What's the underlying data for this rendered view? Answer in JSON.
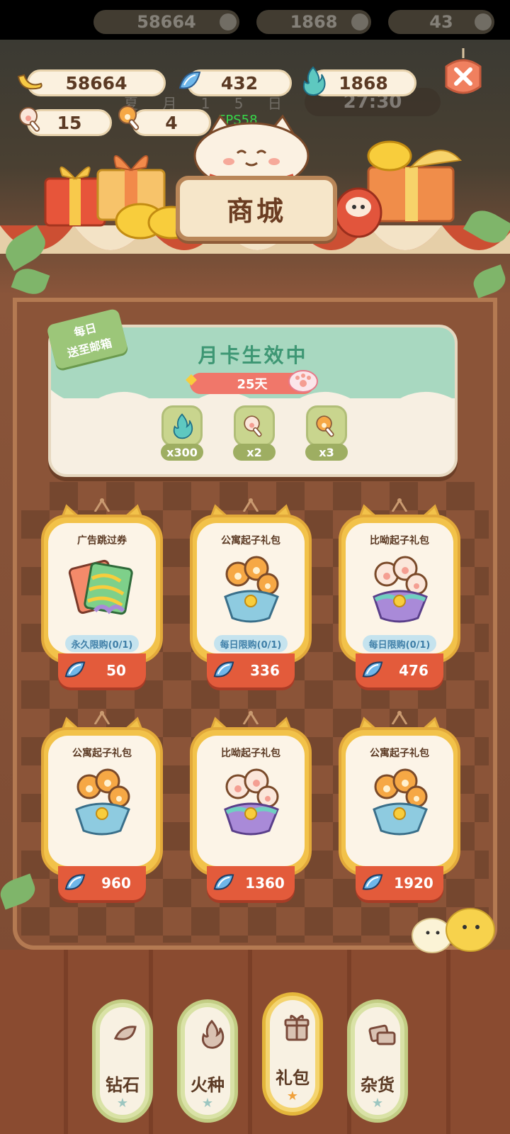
{
  "resources": {
    "banana": "58664",
    "blue_gem": "432",
    "flame": "1868",
    "paw_a": "15",
    "paw_b": "4"
  },
  "background_bar": {
    "banana": "58664",
    "flame": "1868",
    "gem_partial": "43",
    "date_text": "夏 月 1 5 日",
    "timer": "27:30"
  },
  "fps": "FPS58",
  "shop_title": "商城",
  "monthly_card": {
    "tag_line1": "每日",
    "tag_line2": "送至邮箱",
    "title": "月卡生效中",
    "days": "25天",
    "rewards": [
      {
        "icon": "flame-icon",
        "qty": "x300"
      },
      {
        "icon": "paw-drumstick-icon",
        "qty": "x2"
      },
      {
        "icon": "golden-paw-drumstick-icon",
        "qty": "x3"
      }
    ]
  },
  "products": [
    {
      "title": "广告跳过券",
      "limit": "永久限购(0/1)",
      "price": "50",
      "art": "ad-skip-ticket-icon"
    },
    {
      "title": "公寓起子礼包",
      "limit": "每日限购(0/1)",
      "price": "336",
      "art": "golden-paw-bouquet-icon"
    },
    {
      "title": "比呦起子礼包",
      "limit": "每日限购(0/1)",
      "price": "476",
      "art": "pink-paw-bouquet-icon"
    },
    {
      "title": "公寓起子礼包",
      "limit": "",
      "price": "960",
      "art": "golden-paw-bouquet-icon"
    },
    {
      "title": "比呦起子礼包",
      "limit": "",
      "price": "1360",
      "art": "pink-paw-bouquet-icon"
    },
    {
      "title": "公寓起子礼包",
      "limit": "",
      "price": "1920",
      "art": "golden-paw-bouquet-icon"
    }
  ],
  "tabs": [
    {
      "label": "钻石",
      "icon": "gem-icon",
      "active": false
    },
    {
      "label": "火种",
      "icon": "flame-icon",
      "active": false
    },
    {
      "label": "礼包",
      "icon": "gift-icon",
      "active": true
    },
    {
      "label": "杂货",
      "icon": "goods-icon",
      "active": false
    }
  ],
  "colors": {
    "accent_red": "#e35b3b",
    "card_gold": "#f2c24a",
    "month_green": "#3e9774",
    "limit_blue": "#3f7fa8"
  }
}
